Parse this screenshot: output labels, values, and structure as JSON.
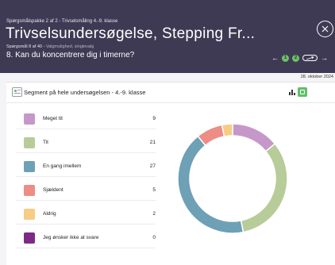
{
  "header": {
    "crumb": "Spørgsmålspakke 2 af 2 - Trivselsmåling 4.-9. klasse",
    "title": "Trivselsundersøgelse, Stepping Fr...",
    "meta_prefix": "Spørgsmål 8 af 40 - ",
    "meta_type": "Valgmulighed, singlevalg",
    "question": "8. Kan du koncentrere dig i timerne?",
    "nav": {
      "prev_icon": "arrow-left-icon",
      "badge1": "1",
      "badge2": "2",
      "next_icon": "arrow-right-icon"
    }
  },
  "date": "28. oktober 2024",
  "segment": {
    "label": "Segment på hele undersøgelsen  - 4.-9. klasse"
  },
  "legend": [
    {
      "label": "Meget tit",
      "count": "9",
      "color": "#c697c9"
    },
    {
      "label": "Tit",
      "count": "21",
      "color": "#b7cc98"
    },
    {
      "label": "En gang imellem",
      "count": "27",
      "color": "#6ea0b6"
    },
    {
      "label": "Sjældent",
      "count": "5",
      "color": "#ee8c86"
    },
    {
      "label": "Aldrig",
      "count": "2",
      "color": "#f7cc85"
    },
    {
      "label": "Jeg ønsker ikke at svare",
      "count": "0",
      "color": "#7d2a86"
    }
  ],
  "chart_data": {
    "type": "pie",
    "categories": [
      "Meget tit",
      "Tit",
      "En gang imellem",
      "Sjældent",
      "Aldrig",
      "Jeg ønsker ikke at svare"
    ],
    "values": [
      9,
      21,
      27,
      5,
      2,
      0
    ],
    "colors": [
      "#c697c9",
      "#b7cc98",
      "#6ea0b6",
      "#ee8c86",
      "#f7cc85",
      "#7d2a86"
    ],
    "donut": true
  }
}
